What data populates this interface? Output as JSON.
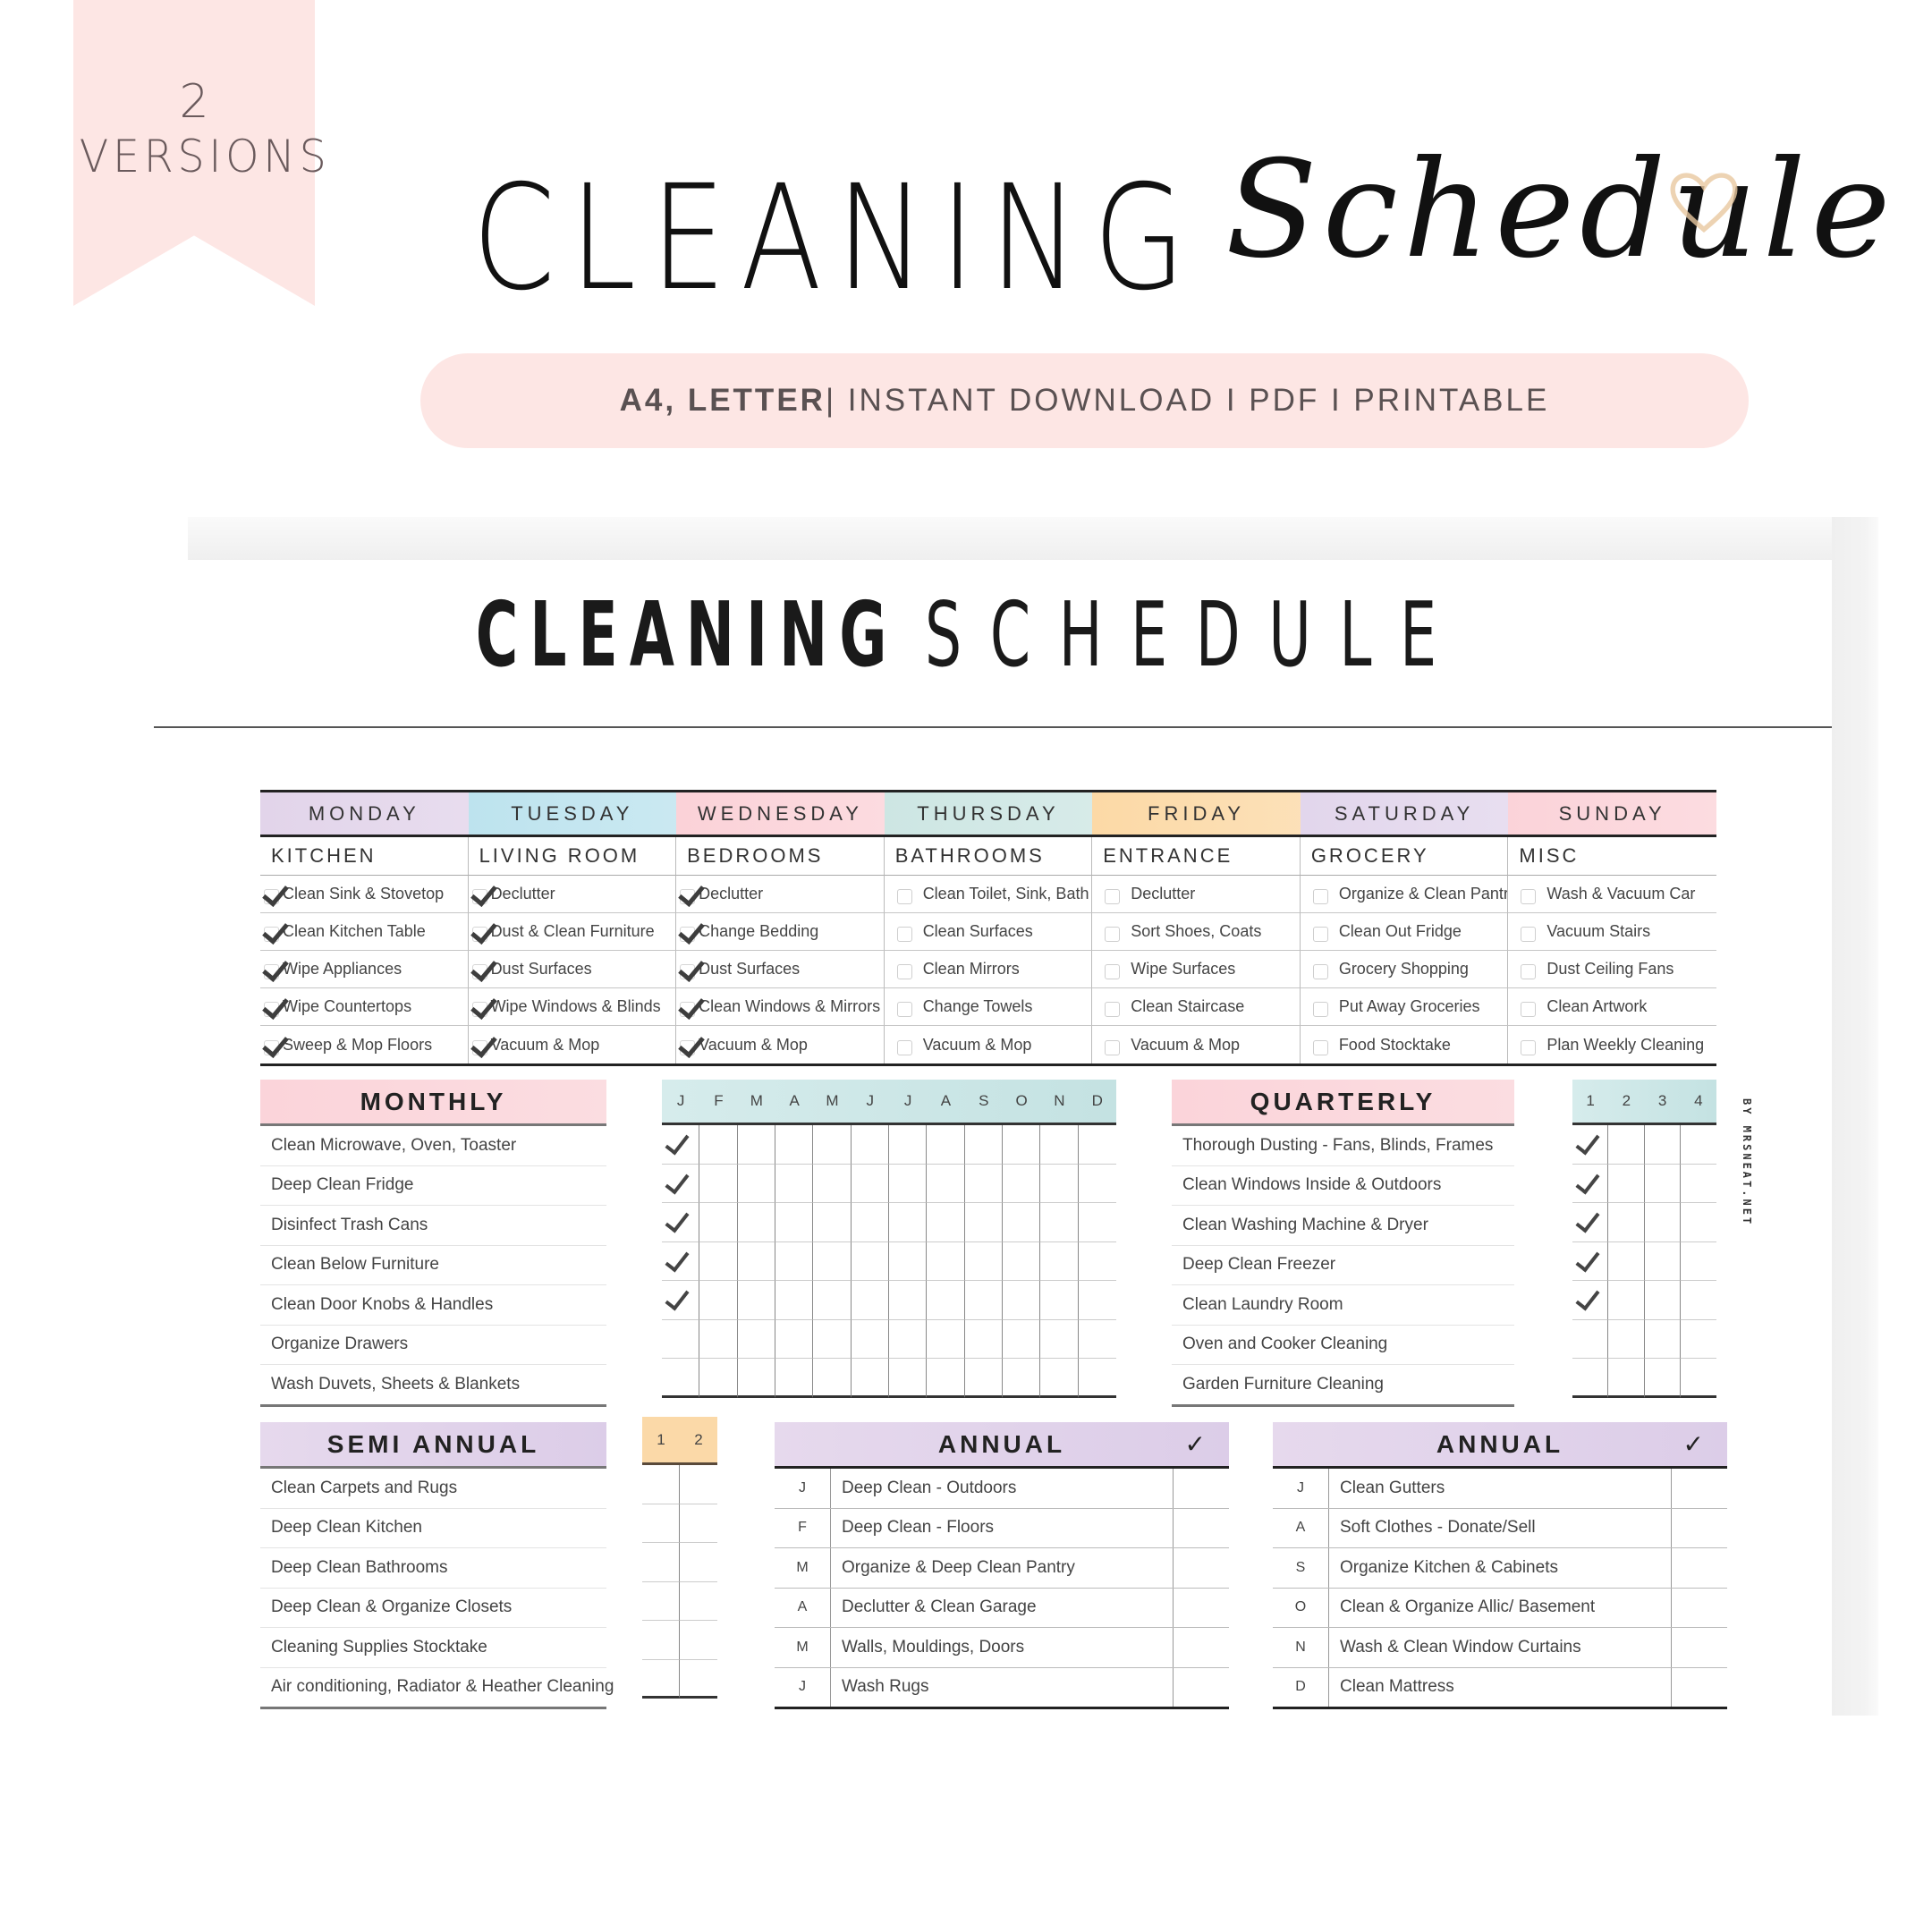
{
  "banner": {
    "ribbon_number": "2",
    "ribbon_label": "VERSIONS",
    "title_main": "CLEANING",
    "title_script": "Schedule",
    "subtitle_bold": "A4, LETTER",
    "subtitle_rest": "| INSTANT DOWNLOAD I PDF I PRINTABLE",
    "accent_color": "#fde6e4"
  },
  "sheet": {
    "title_bold": "CLEANING",
    "title_light": "SCHEDULE",
    "watermark": "BY MRSNEAT.NET"
  },
  "weekly": {
    "days": [
      {
        "day": "MONDAY",
        "color": "#e2d4ea",
        "category": "KITCHEN",
        "tasks": [
          {
            "label": "Clean Sink & Stovetop",
            "checked": true
          },
          {
            "label": "Clean Kitchen Table",
            "checked": true
          },
          {
            "label": "Wipe Appliances",
            "checked": true
          },
          {
            "label": "Wipe Countertops",
            "checked": true
          },
          {
            "label": "Sweep & Mop Floors",
            "checked": true
          }
        ]
      },
      {
        "day": "TUESDAY",
        "color": "#bde3ee",
        "category": "LIVING ROOM",
        "tasks": [
          {
            "label": "Declutter",
            "checked": true
          },
          {
            "label": "Dust & Clean Furniture",
            "checked": true
          },
          {
            "label": "Dust Surfaces",
            "checked": true
          },
          {
            "label": "Wipe Windows & Blinds",
            "checked": true
          },
          {
            "label": "Vacuum & Mop",
            "checked": true
          }
        ]
      },
      {
        "day": "WEDNESDAY",
        "color": "#fbd2d8",
        "category": "BEDROOMS",
        "tasks": [
          {
            "label": "Declutter",
            "checked": true
          },
          {
            "label": "Change Bedding",
            "checked": true
          },
          {
            "label": "Dust Surfaces",
            "checked": true
          },
          {
            "label": "Clean Windows & Mirrors",
            "checked": true
          },
          {
            "label": "Vacuum & Mop",
            "checked": true
          }
        ]
      },
      {
        "day": "THURSDAY",
        "color": "#cde6e3",
        "category": "BATHROOMS",
        "tasks": [
          {
            "label": "Clean Toilet, Sink, Bath",
            "checked": false
          },
          {
            "label": "Clean Surfaces",
            "checked": false
          },
          {
            "label": "Clean Mirrors",
            "checked": false
          },
          {
            "label": "Change Towels",
            "checked": false
          },
          {
            "label": "Vacuum & Mop",
            "checked": false
          }
        ]
      },
      {
        "day": "FRIDAY",
        "color": "#fcd9a6",
        "category": "ENTRANCE",
        "tasks": [
          {
            "label": "Declutter",
            "checked": false
          },
          {
            "label": "Sort Shoes, Coats",
            "checked": false
          },
          {
            "label": "Wipe Surfaces",
            "checked": false
          },
          {
            "label": "Clean Staircase",
            "checked": false
          },
          {
            "label": "Vacuum & Mop",
            "checked": false
          }
        ]
      },
      {
        "day": "SATURDAY",
        "color": "#e2d6ec",
        "category": "GROCERY",
        "tasks": [
          {
            "label": "Organize & Clean Pantry",
            "checked": false
          },
          {
            "label": "Clean Out Fridge",
            "checked": false
          },
          {
            "label": "Grocery Shopping",
            "checked": false
          },
          {
            "label": "Put Away Groceries",
            "checked": false
          },
          {
            "label": "Food Stocktake",
            "checked": false
          }
        ]
      },
      {
        "day": "SUNDAY",
        "color": "#fbd3d9",
        "category": "MISC",
        "tasks": [
          {
            "label": "Wash & Vacuum Car",
            "checked": false
          },
          {
            "label": "Vacuum Stairs",
            "checked": false
          },
          {
            "label": "Dust Ceiling Fans",
            "checked": false
          },
          {
            "label": "Clean Artwork",
            "checked": false
          },
          {
            "label": "Plan Weekly Cleaning",
            "checked": false
          }
        ]
      }
    ]
  },
  "monthly": {
    "title": "MONTHLY",
    "months": [
      "J",
      "F",
      "M",
      "A",
      "M",
      "J",
      "J",
      "A",
      "S",
      "O",
      "N",
      "D"
    ],
    "tasks": [
      {
        "label": "Clean Microwave, Oven, Toaster",
        "done": [
          true,
          false,
          false,
          false,
          false,
          false,
          false,
          false,
          false,
          false,
          false,
          false
        ]
      },
      {
        "label": "Deep Clean Fridge",
        "done": [
          true,
          false,
          false,
          false,
          false,
          false,
          false,
          false,
          false,
          false,
          false,
          false
        ]
      },
      {
        "label": "Disinfect Trash Cans",
        "done": [
          true,
          false,
          false,
          false,
          false,
          false,
          false,
          false,
          false,
          false,
          false,
          false
        ]
      },
      {
        "label": "Clean Below Furniture",
        "done": [
          true,
          false,
          false,
          false,
          false,
          false,
          false,
          false,
          false,
          false,
          false,
          false
        ]
      },
      {
        "label": "Clean Door Knobs & Handles",
        "done": [
          true,
          false,
          false,
          false,
          false,
          false,
          false,
          false,
          false,
          false,
          false,
          false
        ]
      },
      {
        "label": "Organize Drawers",
        "done": [
          false,
          false,
          false,
          false,
          false,
          false,
          false,
          false,
          false,
          false,
          false,
          false
        ]
      },
      {
        "label": "Wash Duvets, Sheets & Blankets",
        "done": [
          false,
          false,
          false,
          false,
          false,
          false,
          false,
          false,
          false,
          false,
          false,
          false
        ]
      }
    ]
  },
  "quarterly": {
    "title": "QUARTERLY",
    "quarters": [
      "1",
      "2",
      "3",
      "4"
    ],
    "tasks": [
      {
        "label": "Thorough Dusting - Fans, Blinds, Frames",
        "done": [
          true,
          false,
          false,
          false
        ]
      },
      {
        "label": "Clean Windows Inside & Outdoors",
        "done": [
          true,
          false,
          false,
          false
        ]
      },
      {
        "label": "Clean Washing Machine & Dryer",
        "done": [
          true,
          false,
          false,
          false
        ]
      },
      {
        "label": "Deep Clean Freezer",
        "done": [
          true,
          false,
          false,
          false
        ]
      },
      {
        "label": "Clean Laundry Room",
        "done": [
          true,
          false,
          false,
          false
        ]
      },
      {
        "label": "Oven and Cooker Cleaning",
        "done": [
          false,
          false,
          false,
          false
        ]
      },
      {
        "label": "Garden Furniture Cleaning",
        "done": [
          false,
          false,
          false,
          false
        ]
      }
    ]
  },
  "semi_annual": {
    "title": "SEMI ANNUAL",
    "halves": [
      "1",
      "2"
    ],
    "tasks": [
      {
        "label": "Clean Carpets and Rugs",
        "done": [
          false,
          false
        ]
      },
      {
        "label": "Deep Clean Kitchen",
        "done": [
          false,
          false
        ]
      },
      {
        "label": "Deep Clean Bathrooms",
        "done": [
          false,
          false
        ]
      },
      {
        "label": "Deep Clean & Organize Closets",
        "done": [
          false,
          false
        ]
      },
      {
        "label": "Cleaning Supplies Stocktake",
        "done": [
          false,
          false
        ]
      },
      {
        "label": "Air conditioning, Radiator & Heather Cleaning",
        "done": [
          false,
          false
        ]
      }
    ]
  },
  "annual": [
    {
      "title": "ANNUAL",
      "check_glyph": "✓",
      "rows": [
        {
          "month": "J",
          "task": "Deep Clean - Outdoors"
        },
        {
          "month": "F",
          "task": "Deep Clean - Floors"
        },
        {
          "month": "M",
          "task": "Organize & Deep Clean Pantry"
        },
        {
          "month": "A",
          "task": "Declutter & Clean Garage"
        },
        {
          "month": "M",
          "task": "Walls, Mouldings, Doors"
        },
        {
          "month": "J",
          "task": "Wash Rugs"
        }
      ]
    },
    {
      "title": "ANNUAL",
      "check_glyph": "✓",
      "rows": [
        {
          "month": "J",
          "task": "Clean Gutters"
        },
        {
          "month": "A",
          "task": "Soft Clothes - Donate/Sell"
        },
        {
          "month": "S",
          "task": "Organize Kitchen & Cabinets"
        },
        {
          "month": "O",
          "task": "Clean & Organize Allic/ Basement"
        },
        {
          "month": "N",
          "task": "Wash & Clean Window Curtains"
        },
        {
          "month": "D",
          "task": "Clean Mattress"
        }
      ]
    }
  ]
}
